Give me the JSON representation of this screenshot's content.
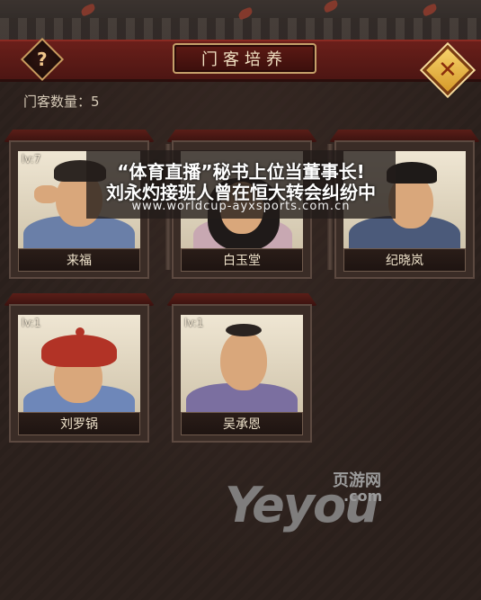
{
  "header": {
    "title": "门客培养",
    "help_icon": "?",
    "close_icon": "✕"
  },
  "retainers": {
    "count_label": "门客数量：5",
    "cards": [
      {
        "level": "lv:7",
        "name": "来福"
      },
      {
        "level": "",
        "name": "白玉堂"
      },
      {
        "level": "",
        "name": "纪晓岚"
      },
      {
        "level": "lv:1",
        "name": "刘罗锅"
      },
      {
        "level": "lv:1",
        "name": "吴承恩"
      }
    ]
  },
  "overlay_banner": {
    "line1": "“体育直播”秘书上位当董事长!",
    "line2": "刘永灼接班人曾在恒大转会纠纷中",
    "url": "www.worldcup-ayxsports.com.cn"
  },
  "watermark": {
    "main": "Yeyou",
    "cn": "页游网",
    "com": ".com"
  },
  "colors": {
    "header_red": "#5c1914",
    "plaque_border": "#c5a06a",
    "close_gold": "#f7d26a"
  }
}
